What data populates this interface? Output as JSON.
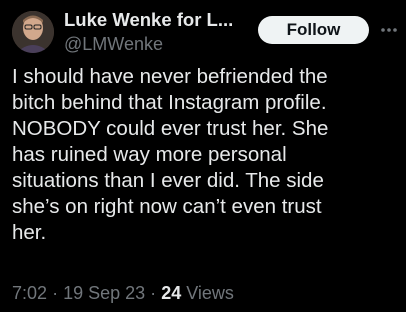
{
  "author": {
    "display_name": "Luke Wenke for L...",
    "handle": "@LMWenke",
    "avatar_icon": "profile-photo"
  },
  "follow_button": {
    "label": "Follow"
  },
  "more_menu": {
    "icon": "more-horizontal-icon"
  },
  "tweet": {
    "lines": [
      "I should have never befriended the",
      "bitch behind that Instagram profile.",
      "NOBODY could ever trust her.  She",
      "has ruined way more personal",
      "situations than I ever did.  The side",
      "she’s on right now can’t even trust",
      "her."
    ]
  },
  "meta": {
    "time": "7:02",
    "separator": "·",
    "date": "19 Sep 23",
    "views_count": "24",
    "views_label": "Views"
  },
  "colors": {
    "background": "#000000",
    "primary_text": "#e7e9ea",
    "secondary_text": "#71767b",
    "button_bg": "#eff3f4",
    "button_text": "#0f1419"
  }
}
